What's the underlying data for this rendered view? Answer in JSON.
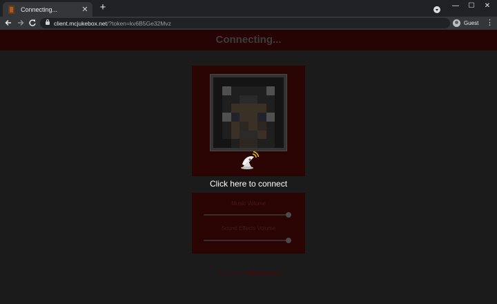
{
  "browser": {
    "tab_title": "Connecting...",
    "tab_close": "✕",
    "new_tab": "+",
    "url_host": "client.mcjukebox.net",
    "url_rest": "/?token=kv6B5Ge32Mvz",
    "profile_label": "Guest",
    "window_controls": [
      "—",
      "☐",
      "✕"
    ],
    "nav_icons": [
      "arrow-left-icon",
      "arrow-right-icon",
      "reload-icon"
    ]
  },
  "page": {
    "title": "Connecting...",
    "connect_text": "Click here to connect",
    "music_volume_label": "Music Volume",
    "music_volume_value": 0.98,
    "sound_effects_label": "Sound Effects Volume",
    "sound_effects_value": 0.98,
    "powered_by_prefix": "Powered by ",
    "powered_by_brand": "MCJukebox"
  },
  "colors": {
    "header_bg": "#260404",
    "card_bg": "#2a0303",
    "page_bg": "#1b1b1b"
  }
}
